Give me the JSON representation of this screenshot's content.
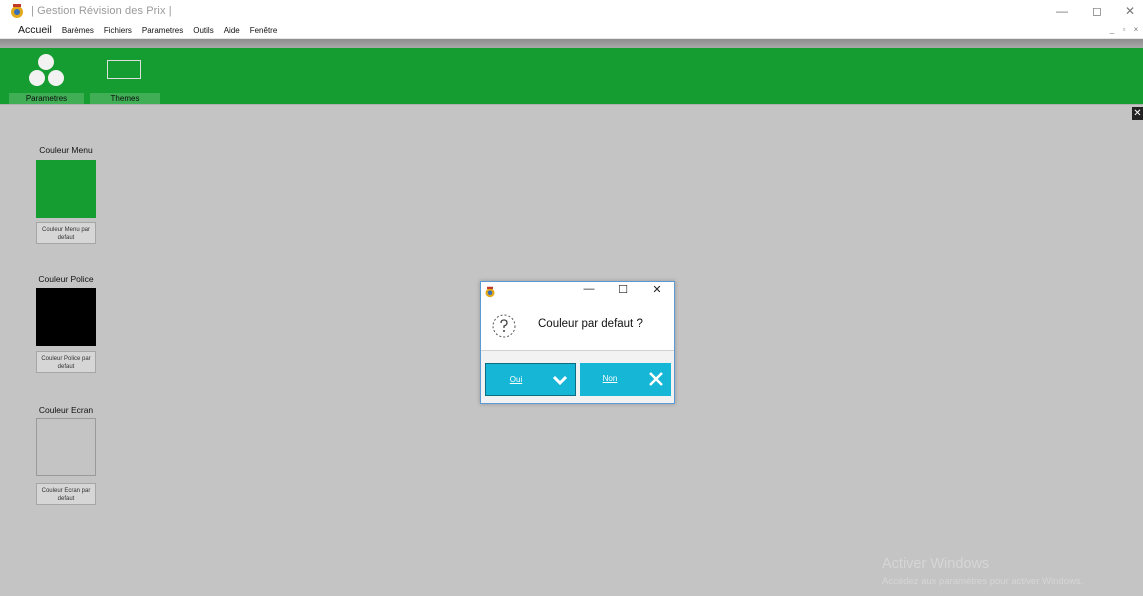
{
  "window": {
    "title": "|  Gestion Révision des Prix  |",
    "controls": [
      "minimize",
      "restore",
      "close"
    ]
  },
  "menubar": {
    "items": [
      "Accueil",
      "Barèmes",
      "Fichiers",
      "Parametres",
      "Outils",
      "Aide",
      "Fenêtre"
    ],
    "mdi_controls": [
      "_",
      "▫",
      "×"
    ]
  },
  "ribbon": {
    "color": "#169d32",
    "buttons": [
      {
        "label": "Parametres",
        "icon": "circles-settings-icon"
      },
      {
        "label": "Themes",
        "icon": "monitor-icon"
      }
    ]
  },
  "settings": {
    "menu": {
      "label": "Couleur Menu",
      "color": "#169d32",
      "reset_label": "Couleur Menu par defaut"
    },
    "police": {
      "label": "Couleur Police",
      "color": "#000000",
      "reset_label": "Couleur Police par defaut"
    },
    "ecran": {
      "label": "Couleur Ecran",
      "color": "#c4c4c4",
      "reset_label": "Couleur Ecran par defaut"
    }
  },
  "dialog": {
    "message": "Couleur par defaut  ?",
    "icon": "question-icon",
    "yes_label": "Oui",
    "no_label": "Non",
    "button_color": "#16b6d6"
  },
  "watermark": {
    "line1": "Activer Windows",
    "line2": "Accédez aux paramètres pour activer Windows."
  }
}
